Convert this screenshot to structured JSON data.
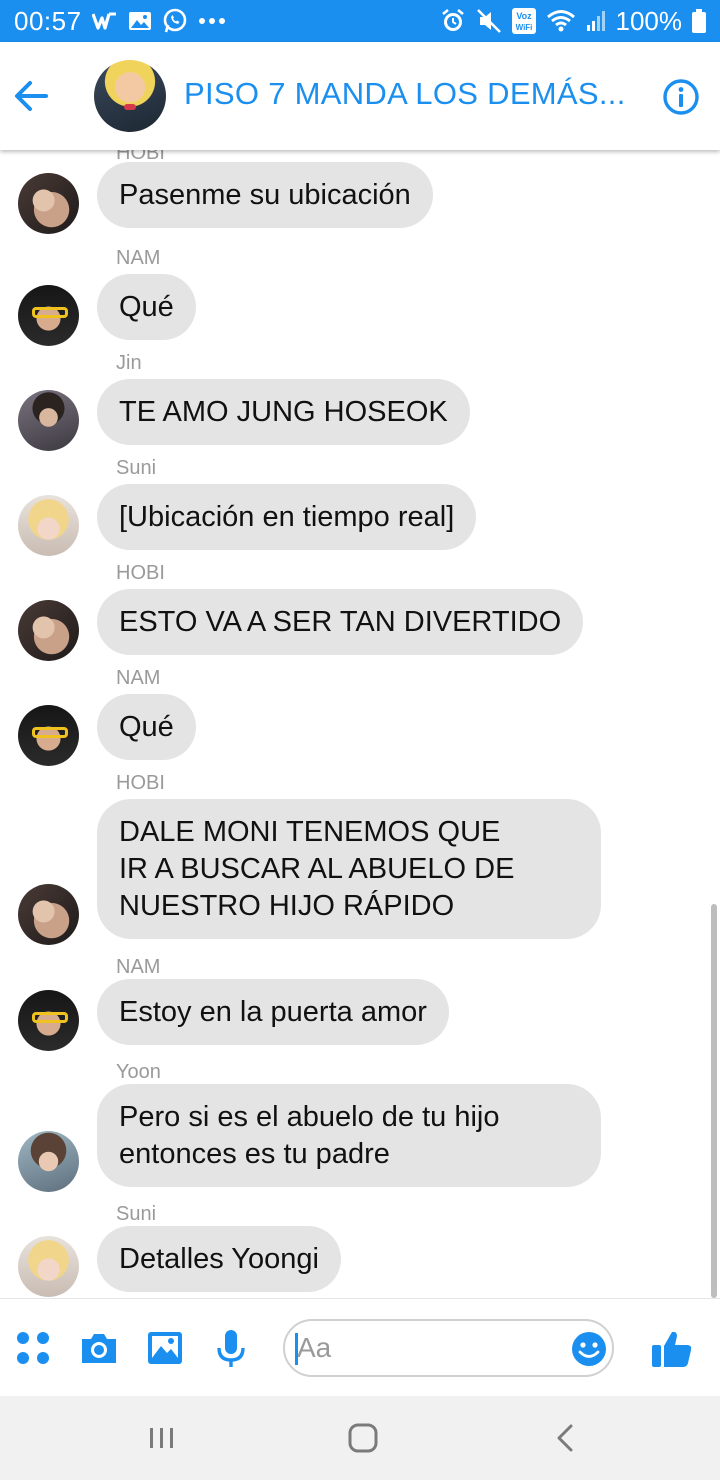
{
  "status_bar": {
    "time": "00:57",
    "battery": "100%",
    "left_icons": [
      "w-app-icon",
      "gallery-icon",
      "whatsapp-icon",
      "more-dots-icon"
    ],
    "right_icons": [
      "alarm-icon",
      "mute-icon",
      "voz-wifi-icon",
      "wifi-icon",
      "signal-icon",
      "battery-icon"
    ],
    "voz_wifi_label": "Voz\nWiFi"
  },
  "header": {
    "title": "PISO 7 MANDA LOS DEMÁS...",
    "accent_color": "#1a8ff0"
  },
  "messages": [
    {
      "sender": "HOBI",
      "text": "Pasenme su ubicación",
      "avatar": "hobi"
    },
    {
      "sender": "NAM",
      "text": "Qué",
      "avatar": "nam"
    },
    {
      "sender": "Jin",
      "text": "TE AMO JUNG HOSEOK",
      "avatar": "jin"
    },
    {
      "sender": "Suni",
      "text": "[Ubicación en tiempo real]",
      "avatar": "suni"
    },
    {
      "sender": "HOBI",
      "text": "ESTO VA A  SER TAN DIVERTIDO",
      "avatar": "hobi"
    },
    {
      "sender": "NAM",
      "text": "Qué",
      "avatar": "nam"
    },
    {
      "sender": "HOBI",
      "text": "DALE MONI TENEMOS QUE\nIR A BUSCAR AL ABUELO DE\nNUESTRO HIJO RÁPIDO",
      "avatar": "hobi"
    },
    {
      "sender": "NAM",
      "text": "Estoy en la puerta amor",
      "avatar": "nam"
    },
    {
      "sender": "Yoon",
      "text": "Pero si es el abuelo de tu hijo\nentonces es tu padre",
      "avatar": "yoon"
    },
    {
      "sender": "Suni",
      "text": "Detalles Yoongi",
      "avatar": "suni"
    }
  ],
  "composer": {
    "placeholder": "Aa",
    "value": "",
    "icons": [
      "apps-icon",
      "camera-icon",
      "image-icon",
      "microphone-icon",
      "emoji-icon",
      "thumbs-up-icon"
    ]
  },
  "nav": {
    "icons": [
      "recent-apps-icon",
      "home-icon",
      "back-icon"
    ]
  }
}
